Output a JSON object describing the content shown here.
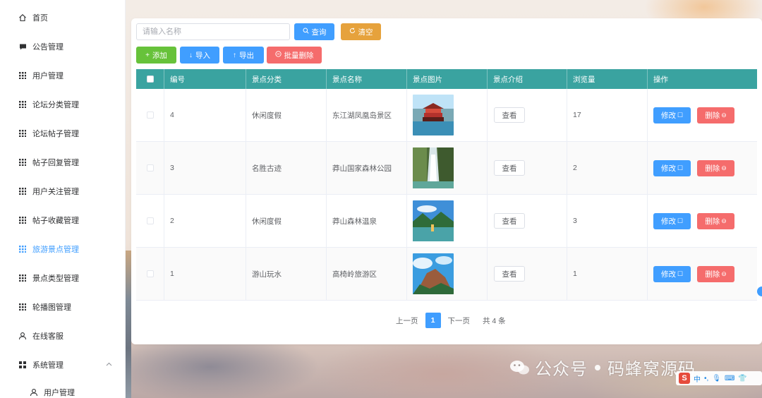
{
  "sidebar": {
    "items": [
      {
        "label": "首页",
        "icon": "home-icon"
      },
      {
        "label": "公告管理",
        "icon": "message-icon"
      },
      {
        "label": "用户管理",
        "icon": "grid-icon"
      },
      {
        "label": "论坛分类管理",
        "icon": "grid-icon"
      },
      {
        "label": "论坛帖子管理",
        "icon": "grid-icon"
      },
      {
        "label": "帖子回复管理",
        "icon": "grid-icon"
      },
      {
        "label": "用户关注管理",
        "icon": "grid-icon"
      },
      {
        "label": "帖子收藏管理",
        "icon": "grid-icon"
      },
      {
        "label": "旅游景点管理",
        "icon": "grid-icon"
      },
      {
        "label": "景点类型管理",
        "icon": "grid-icon"
      },
      {
        "label": "轮播图管理",
        "icon": "grid-icon"
      },
      {
        "label": "在线客服",
        "icon": "user-icon"
      },
      {
        "label": "系统管理",
        "icon": "quad-icon"
      },
      {
        "label": "用户管理",
        "icon": "user-icon"
      }
    ],
    "active_index": 8,
    "active_color": "#409eff"
  },
  "toolbar": {
    "search_placeholder": "请输入名称",
    "query_label": "查询",
    "clear_label": "清空",
    "add_label": "添加",
    "import_label": "导入",
    "export_label": "导出",
    "batch_delete_label": "批量删除"
  },
  "table": {
    "header_color": "#3aa3a0",
    "columns": [
      "编号",
      "景点分类",
      "景点名称",
      "景点图片",
      "景点介绍",
      "浏览量",
      "操作"
    ],
    "rows": [
      {
        "id": "4",
        "category": "休闲度假",
        "name": "东江湖凤凰岛景区",
        "intro_label": "查看",
        "views": "17",
        "edit_label": "修改",
        "delete_label": "删除"
      },
      {
        "id": "3",
        "category": "名胜古迹",
        "name": "莽山国家森林公园",
        "intro_label": "查看",
        "views": "2",
        "edit_label": "修改",
        "delete_label": "删除"
      },
      {
        "id": "2",
        "category": "休闲度假",
        "name": "莽山森林温泉",
        "intro_label": "查看",
        "views": "3",
        "edit_label": "修改",
        "delete_label": "删除"
      },
      {
        "id": "1",
        "category": "游山玩水",
        "name": "高椅岭旅游区",
        "intro_label": "查看",
        "views": "1",
        "edit_label": "修改",
        "delete_label": "删除"
      }
    ]
  },
  "pagination": {
    "prev_label": "上一页",
    "current_page": "1",
    "next_label": "下一页",
    "total_label": "共 4 条"
  },
  "watermark": {
    "text_left": "公众号",
    "text_right": "码蜂窝源码"
  },
  "ime": {
    "logo": "S",
    "lang": "中"
  }
}
